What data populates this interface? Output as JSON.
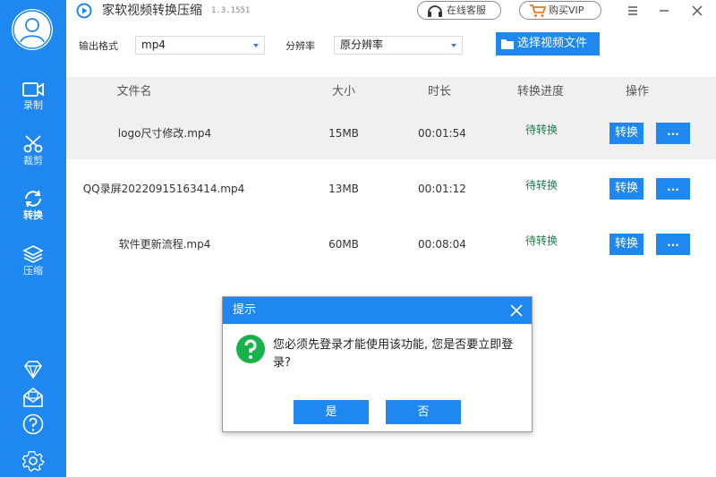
{
  "app": {
    "title": "家软视频转换压缩",
    "version": "1.3.1551"
  },
  "header": {
    "support_label": "在线客服",
    "vip_label": "购买VIP"
  },
  "sidebar": {
    "items": [
      {
        "label": "录制",
        "icon": "video-camera-icon"
      },
      {
        "label": "裁剪",
        "icon": "scissors-icon"
      },
      {
        "label": "转换",
        "icon": "convert-icon"
      },
      {
        "label": "压缩",
        "icon": "layers-icon"
      }
    ],
    "active_index": 2
  },
  "settings": {
    "format_label": "输出格式",
    "format_value": "mp4",
    "resolution_label": "分辨率",
    "resolution_value": "原分辨率",
    "choose_button": "选择视频文件"
  },
  "table": {
    "columns": [
      "文件名",
      "大小",
      "时长",
      "转换进度",
      "操作"
    ],
    "rows": [
      {
        "name": "logo尺寸修改.mp4",
        "size": "15MB",
        "duration": "00:01:54",
        "status": "待转换",
        "action": "转换",
        "more": "..."
      },
      {
        "name": "QQ录屏20220915163414.mp4",
        "size": "13MB",
        "duration": "00:01:12",
        "status": "待转换",
        "action": "转换",
        "more": "..."
      },
      {
        "name": "软件更新流程.mp4",
        "size": "60MB",
        "duration": "00:08:04",
        "status": "待转换",
        "action": "转换",
        "more": "..."
      }
    ]
  },
  "dialog": {
    "title": "提示",
    "message": "您必须先登录才能使用该功能, 您是否要立即登录?",
    "yes_label": "是",
    "no_label": "否"
  },
  "colors": {
    "accent": "#1e88f0",
    "status_pending": "#1f7a4a",
    "question_icon": "#18b24b"
  }
}
